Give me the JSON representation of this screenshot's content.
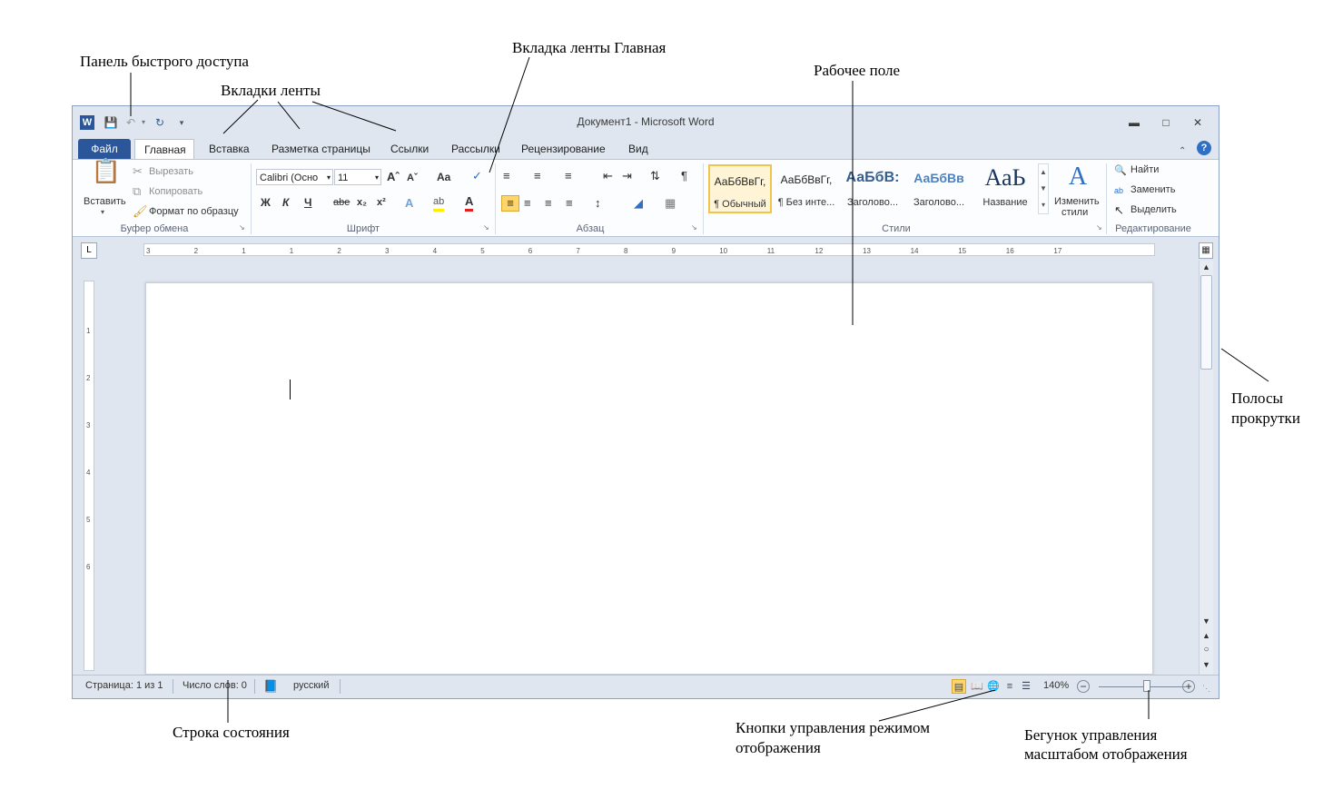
{
  "annotations": {
    "quick_access": "Панель быстрого доступа",
    "ribbon_tabs": "Вкладки ленты",
    "home_tab": "Вкладка ленты Главная",
    "workspace": "Рабочее поле",
    "scrollbars_line1": "Полосы",
    "scrollbars_line2": "прокрутки",
    "status_bar": "Строка состояния",
    "view_buttons_line1": "Кнопки управления режимом",
    "view_buttons_line2": "отображения",
    "zoom_slider_line1": "Бегунок управления",
    "zoom_slider_line2": "масштабом отображения"
  },
  "window": {
    "title": "Документ1  -  Microsoft Word",
    "app_icon": "W"
  },
  "tabs": [
    "Файл",
    "Главная",
    "Вставка",
    "Разметка страницы",
    "Ссылки",
    "Рассылки",
    "Рецензирование",
    "Вид"
  ],
  "clipboard": {
    "paste": "Вставить",
    "cut": "Вырезать",
    "copy": "Копировать",
    "format_painter": "Формат по образцу",
    "label": "Буфер обмена"
  },
  "font": {
    "name": "Calibri (Осно",
    "size": "11",
    "label": "Шрифт",
    "change_case": "Aa",
    "bold": "Ж",
    "italic": "К",
    "underline": "Ч",
    "strike": "abe",
    "sub": "x₂",
    "sup": "x²"
  },
  "paragraph": {
    "label": "Абзац"
  },
  "styles": {
    "items": [
      {
        "sample": "АаБбВвГг,",
        "name": "¶ Обычный"
      },
      {
        "sample": "АаБбВвГг,",
        "name": "¶ Без инте..."
      },
      {
        "sample": "АаБбВ:",
        "name": "Заголово..."
      },
      {
        "sample": "АаБбВв",
        "name": "Заголово..."
      },
      {
        "sample": "АаЬ",
        "name": "Название"
      }
    ],
    "change_line1": "Изменить",
    "change_line2": "стили",
    "label": "Стили"
  },
  "editing": {
    "find": "Найти",
    "replace": "Заменить",
    "select": "Выделить",
    "label": "Редактирование"
  },
  "ruler_numbers": [
    "3",
    "2",
    "1",
    "1",
    "2",
    "3",
    "4",
    "5",
    "6",
    "7",
    "8",
    "9",
    "10",
    "11",
    "12",
    "13",
    "14",
    "15",
    "16",
    "17"
  ],
  "vruler_numbers": [
    "1",
    "2",
    "3",
    "4",
    "5",
    "6"
  ],
  "status": {
    "page": "Страница: 1 из 1",
    "words": "Число слов: 0",
    "language": "русский",
    "zoom": "140%"
  },
  "zoom_level_percent": 140
}
